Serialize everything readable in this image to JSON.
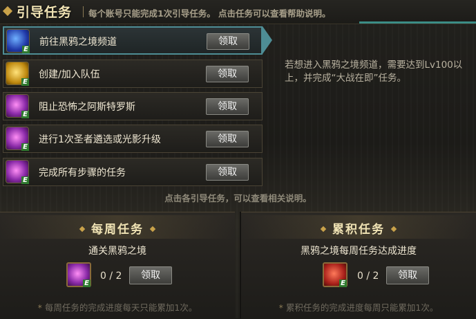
{
  "header": {
    "title": "引导任务",
    "description": "每个账号只能完成1次引导任务。 点击任务可以查看帮助说明。"
  },
  "quests": [
    {
      "label": "前往黑鸦之境频道",
      "button": "领取",
      "icon": "blue-box-icon"
    },
    {
      "label": "创建/加入队伍",
      "button": "领取",
      "icon": "gold-coin-icon"
    },
    {
      "label": "阻止恐怖之阿斯特罗斯",
      "button": "领取",
      "icon": "purple-orb-icon"
    },
    {
      "label": "进行1次圣者遴选或光影升级",
      "button": "领取",
      "icon": "purple-orb-icon"
    },
    {
      "label": "完成所有步骤的任务",
      "button": "领取",
      "icon": "purple-orb-icon"
    }
  ],
  "help_text": "若想进入黑鸦之境频道，需要达到Lv100以上，并完成“大战在即”任务。",
  "hint": "点击各引导任务，可以查看相关说明。",
  "weekly": {
    "title": "每周任务",
    "subtitle": "通关黑鸦之境",
    "progress": "0 / 2",
    "button": "领取",
    "note": "每周任务的完成进度每天只能累加1次。"
  },
  "cumulative": {
    "title": "累积任务",
    "subtitle": "黑鸦之境每周任务达成进度",
    "progress": "0 / 2",
    "button": "领取",
    "note": "累积任务的完成进度每周只能累加1次。"
  },
  "colors": {
    "accent": "#4e8d95",
    "gold": "#c9a24a",
    "title": "#f0e3b4"
  }
}
